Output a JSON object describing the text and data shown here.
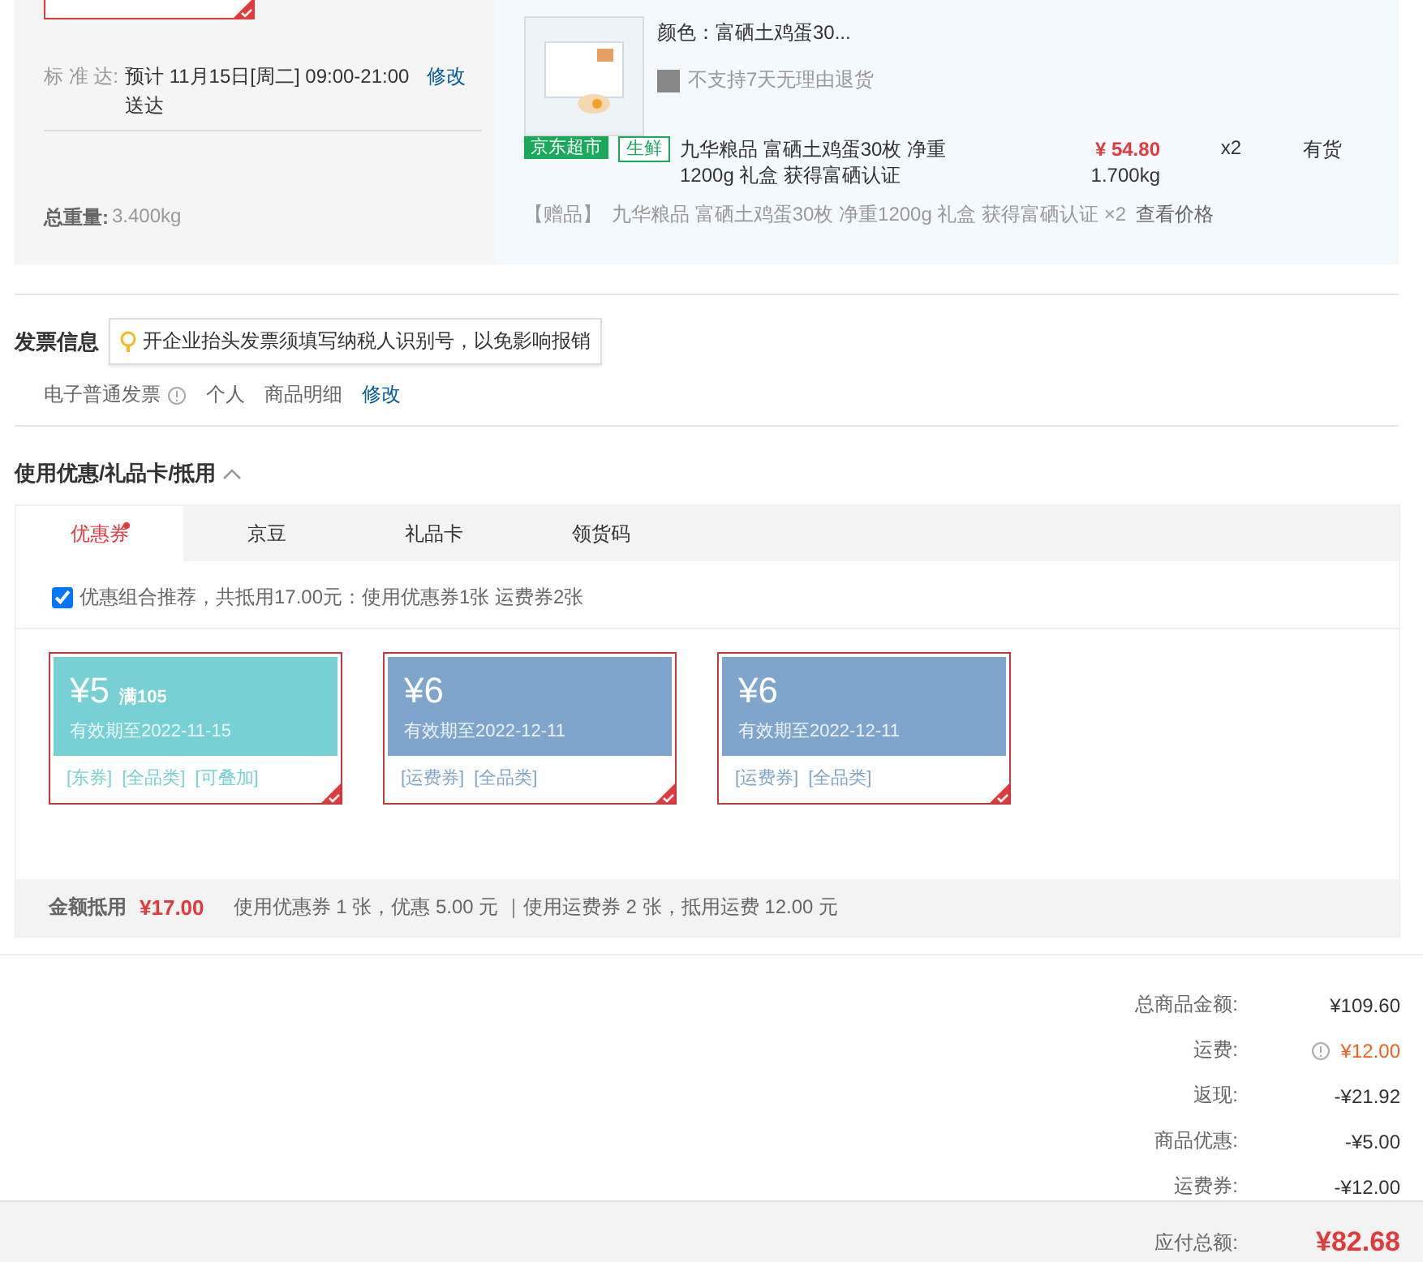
{
  "shipping": {
    "option": {
      "selected": true
    },
    "delivery_label": "标 准 达:",
    "delivery_time": "预计 11月15日[周二] 09:00-21:00 送达",
    "delivery_edit": "修改",
    "weight_label": "总重量:",
    "weight_value": "3.400kg"
  },
  "product": {
    "spec": "颜色：富硒土鸡蛋30...",
    "return_policy": "不支持7天无理由退货",
    "tags": [
      "京东超市",
      "生鲜"
    ],
    "name": "九华粮品 富硒土鸡蛋30枚 净重1200g 礼盒 获得富硒认证",
    "price": "¥ 54.80",
    "weight": "1.700kg",
    "quantity": "x2",
    "stock": "有货",
    "gift_label": "【赠品】",
    "gift": "九华粮品 富硒土鸡蛋30枚 净重1200g 礼盒 获得富硒认证 ×2",
    "gift_link": "查看价格"
  },
  "invoice": {
    "title": "发票信息",
    "tip": "开企业抬头发票须填写纳税人识别号，以免影响报销",
    "type": "电子普通发票",
    "holder": "个人",
    "content": "商品明细",
    "edit": "修改"
  },
  "discounts": {
    "title": "使用优惠/礼品卡/抵用",
    "expanded": true,
    "tabs": [
      {
        "label": "优惠券",
        "selected": true,
        "dot": true
      },
      {
        "label": "京豆",
        "selected": false,
        "dot": false
      },
      {
        "label": "礼品卡",
        "selected": false,
        "dot": false
      },
      {
        "label": "领货码",
        "selected": false,
        "dot": false
      }
    ],
    "recommend": {
      "checked": true,
      "text": "优惠组合推荐，共抵用17.00元：使用优惠券1张 运费券2张"
    },
    "coupons": [
      {
        "amount": "¥5",
        "condition": "满105",
        "validity": "有效期至2022-11-15",
        "tags": [
          "[东券]",
          "[全品类]",
          "[可叠加]"
        ],
        "color": "#77d1d4",
        "selected": true
      },
      {
        "amount": "¥6",
        "validity": "有效期至2022-12-11",
        "tags": [
          "[运费券]",
          "[全品类]"
        ],
        "color": "#7fa5cc",
        "selected": true
      },
      {
        "amount": "¥6",
        "validity": "有效期至2022-12-11",
        "tags": [
          "[运费券]",
          "[全品类]"
        ],
        "color": "#7fa5cc",
        "selected": true
      }
    ],
    "summary_label": "金额抵用",
    "summary_amount": "¥17.00",
    "summary_detail": "使用优惠券 1 张，优惠 5.00 元 ｜使用运费券 2 张，抵用运费 12.00 元"
  },
  "totals": [
    {
      "label": "总商品金额:",
      "value": "¥109.60",
      "kind": "plain"
    },
    {
      "label": "运费:",
      "value": "¥12.00",
      "kind": "info"
    },
    {
      "label": "返现:",
      "value": "-¥21.92",
      "kind": "plain"
    },
    {
      "label": "商品优惠:",
      "value": "-¥5.00",
      "kind": "plain"
    },
    {
      "label": "运费券:",
      "value": "-¥12.00",
      "kind": "plain"
    }
  ],
  "payable": {
    "label": "应付总额:",
    "value": "¥82.68"
  }
}
